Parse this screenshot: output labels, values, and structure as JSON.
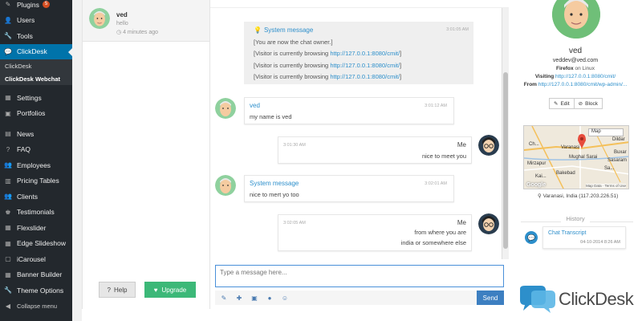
{
  "sidebar": {
    "items": [
      {
        "label": "Plugins",
        "badge": "5",
        "icon": "plug-icon"
      },
      {
        "label": "Users",
        "icon": "users-icon"
      },
      {
        "label": "Tools",
        "icon": "wrench-icon"
      },
      {
        "label": "ClickDesk",
        "icon": "chat-icon"
      },
      {
        "label": "Settings",
        "icon": "settings-icon"
      },
      {
        "label": "Portfolios",
        "icon": "portfolio-icon"
      },
      {
        "label": "News",
        "icon": "news-icon"
      },
      {
        "label": "FAQ",
        "icon": "question-icon"
      },
      {
        "label": "Employees",
        "icon": "employees-icon"
      },
      {
        "label": "Pricing Tables",
        "icon": "pricing-icon"
      },
      {
        "label": "Clients",
        "icon": "clients-icon"
      },
      {
        "label": "Testimonials",
        "icon": "testimonials-icon"
      },
      {
        "label": "Flexslider",
        "icon": "slider-icon"
      },
      {
        "label": "Edge Slideshow",
        "icon": "slideshow-icon"
      },
      {
        "label": "iCarousel",
        "icon": "carousel-icon"
      },
      {
        "label": "Banner Builder",
        "icon": "banner-icon"
      },
      {
        "label": "Theme Options",
        "icon": "options-icon"
      },
      {
        "label": "Collapse menu",
        "icon": "collapse-icon"
      }
    ],
    "submenu": [
      "ClickDesk",
      "ClickDesk Webchat"
    ]
  },
  "visitor": {
    "name": "ved",
    "last_message": "hello",
    "time": "4 minutes ago"
  },
  "panel_buttons": {
    "help": "Help",
    "upgrade": "Upgrade"
  },
  "system_message": {
    "title": "System message",
    "time": "3:01:05 AM",
    "lines": [
      {
        "text": "[You are now the chat owner.]",
        "link": ""
      },
      {
        "prefix": "[Visitor is currently browsing ",
        "link": "http://127.0.0.1:8080/cmit/",
        "suffix": "]"
      },
      {
        "prefix": "[Visitor is currently browsing ",
        "link": "http://127.0.0.1:8080/cmit/",
        "suffix": "]"
      },
      {
        "prefix": "[Visitor is currently browsing ",
        "link": "http://127.0.0.1:8080/cmit/",
        "suffix": "]"
      }
    ]
  },
  "messages": [
    {
      "sender": "ved",
      "time": "3:01:12 AM",
      "text": "my name is ved",
      "side": "left"
    },
    {
      "sender": "Me",
      "time": "3:01:30 AM",
      "text": "nice to meet you",
      "side": "right"
    },
    {
      "sender": "System message",
      "time": "3:02:01 AM",
      "text": "nice to mert yo too",
      "side": "left"
    },
    {
      "sender": "Me",
      "time": "3:02:05 AM",
      "text": "from where you are",
      "text2": "india or somewhere else",
      "side": "right"
    }
  ],
  "composer": {
    "placeholder": "Type a message here...",
    "send": "Send",
    "tools": [
      "attach-icon",
      "plus-icon",
      "calendar-icon",
      "record-icon",
      "smiley-icon"
    ]
  },
  "profile": {
    "name": "ved",
    "email": "veddev@ved.com",
    "browser": "Firefox",
    "os_text": "on Linux",
    "visiting_label": "Visiting",
    "visiting_url": "http://127.0.0.1:8080/cmit/",
    "from_label": "From",
    "from_url": "http://127.0.0.1:8080/cmit/wp-admin/...",
    "edit": "Edit",
    "block": "Block",
    "location": "Varanasi, India (117.203.226.51)",
    "map": {
      "select": "Map",
      "labels": [
        "Dildar",
        "Varanasi",
        "Mughal Sarai",
        "Mirzapur",
        "Bakebad",
        "Buxar",
        "Ch...",
        "Sa...",
        "Kai...",
        "Sasaram"
      ],
      "google": "Google",
      "footer": "Map Data · Terms of Use"
    },
    "history_title": "History",
    "transcript_title": "Chat Transcript",
    "transcript_time": "04-10-2014 8:26 AM"
  },
  "brand": {
    "name": "ClickDesk",
    "accent": "#2d8fcb"
  }
}
